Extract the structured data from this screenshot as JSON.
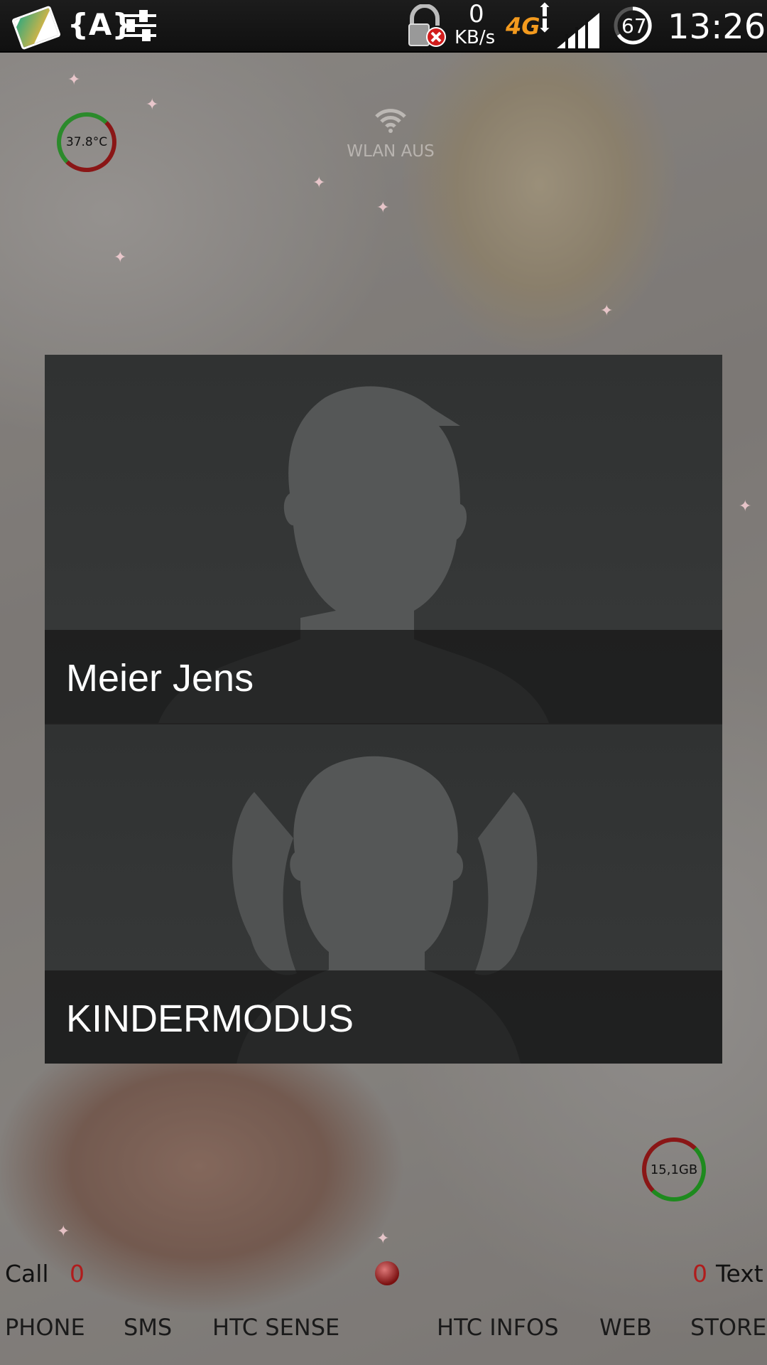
{
  "status_bar": {
    "icons": {
      "gallery": "photo-icon",
      "font": "font-braces-icon",
      "settings": "sliders-icon",
      "lock": "lock-blocked-icon",
      "network": "4g-icon",
      "data_arrows": "data-transfer-icon",
      "signal": "signal-icon",
      "battery": "battery-ring-icon"
    },
    "data_rate_value": "0",
    "data_rate_unit": "KB/s",
    "network_type": "4G",
    "battery_level": "67",
    "time": "13:26"
  },
  "widgets": {
    "temperature": "37.8°C",
    "wifi_status": "WLAN AUS",
    "storage": "15,1GB"
  },
  "users": [
    {
      "name": "Meier Jens",
      "avatar": "male-avatar-icon"
    },
    {
      "name": "KINDERMODUS",
      "avatar": "girl-avatar-icon"
    }
  ],
  "counters": {
    "call_label": "Call",
    "call_count": "0",
    "text_label": "Text",
    "text_count": "0"
  },
  "dock": {
    "phone": "PHONE",
    "sms": "SMS",
    "htc_sense": "HTC SENSE",
    "htc_infos": "HTC INFOS",
    "web": "WEB",
    "store": "STORE"
  },
  "colors": {
    "panel_bg": "#2f3131",
    "name_bar": "#161616",
    "accent_orange": "#f39a1e",
    "count_red": "#b01c1c",
    "ring_green": "#2b8a2b",
    "ring_red": "#8a1616"
  }
}
